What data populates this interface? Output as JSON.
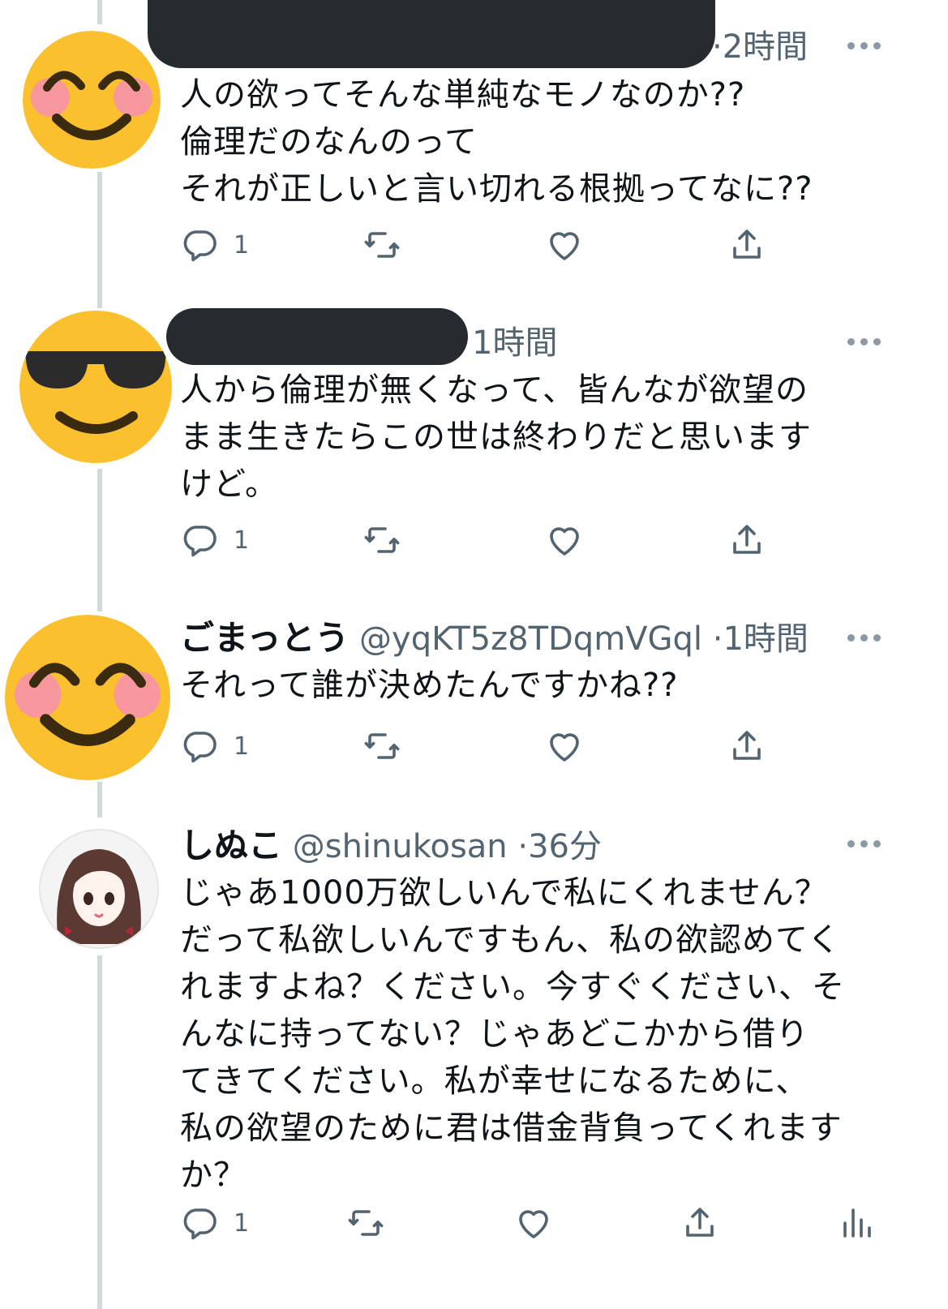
{
  "tweets": [
    {
      "time": "2時間",
      "text": "人の欲ってそんな単純なモノなのか??\n倫理だのなんのって\nそれが正しいと言い切れる根拠ってなに??",
      "replies": "1"
    },
    {
      "time": "1時間",
      "text": "人から倫理が無くなって、皆んなが欲望の\nまま生きたらこの世は終わりだと思います\nけど。",
      "replies": "1"
    },
    {
      "name": "ごまっとう",
      "handle": "@yqKT5z8TDqmVGql",
      "time": "1時間",
      "text": "それって誰が決めたんですかね??",
      "replies": "1"
    },
    {
      "name": "しぬこ",
      "handle": "@shinukosan",
      "time": "36分",
      "text": "じゃあ1000万欲しいんで私にくれません？\nだって私欲しいんですもん、私の欲認めてく\nれますよね？ください。今すぐください、そ\nんなに持ってない？じゃあどこかから借り\nてきてください。私が幸せになるために、\n私の欲望のために君は借金背負ってくれます\nか？",
      "replies": "1"
    }
  ],
  "colors": {
    "emoji_face": "#fbc02d",
    "blush": "#f48fb1",
    "icon": "#536471",
    "thread_line": "#cfd9de"
  }
}
